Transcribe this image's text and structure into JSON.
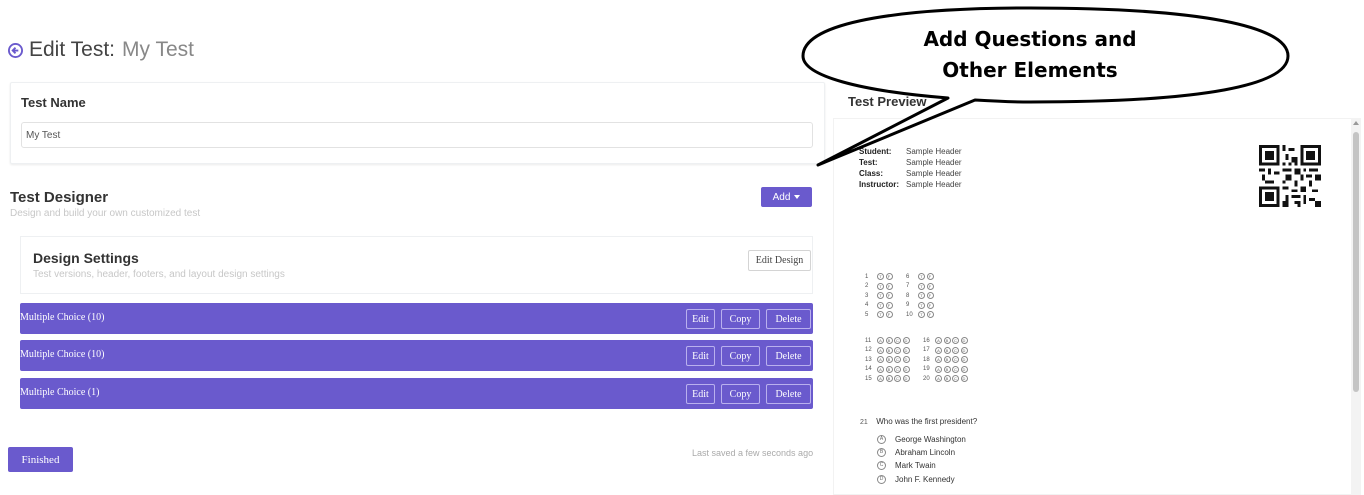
{
  "header": {
    "title_prefix": "Edit Test:",
    "title_name": "My Test"
  },
  "test_name": {
    "label": "Test Name",
    "value": "My Test"
  },
  "designer": {
    "title": "Test Designer",
    "subtitle": "Design and build your own customized test",
    "add_label": "Add"
  },
  "design_settings": {
    "title": "Design Settings",
    "subtitle": "Test versions, header, footers, and layout design settings",
    "edit_label": "Edit Design"
  },
  "sections": [
    {
      "label": "Multiple Choice (10)",
      "edit": "Edit",
      "copy": "Copy",
      "delete": "Delete"
    },
    {
      "label": "Multiple Choice (10)",
      "edit": "Edit",
      "copy": "Copy",
      "delete": "Delete"
    },
    {
      "label": "Multiple Choice (1)",
      "edit": "Edit",
      "copy": "Copy",
      "delete": "Delete"
    }
  ],
  "footer": {
    "finished_label": "Finished",
    "last_saved": "Last saved a few seconds ago"
  },
  "preview": {
    "title": "Test Preview",
    "header_rows": [
      {
        "key": "Student:",
        "value": "Sample Header"
      },
      {
        "key": "Test:",
        "value": "Sample Header"
      },
      {
        "key": "Class:",
        "value": "Sample Header"
      },
      {
        "key": "Instructor:",
        "value": "Sample Header"
      }
    ],
    "block_one": {
      "left_numbers": [
        "1",
        "2",
        "3",
        "4",
        "5"
      ],
      "right_numbers": [
        "6",
        "7",
        "8",
        "9",
        "10"
      ],
      "bubbles": [
        "T",
        "F"
      ]
    },
    "block_two": {
      "left_numbers": [
        "11",
        "12",
        "13",
        "14",
        "15"
      ],
      "right_numbers": [
        "16",
        "17",
        "18",
        "19",
        "20"
      ],
      "bubbles": [
        "A",
        "B",
        "C",
        "D"
      ]
    },
    "question": {
      "number": "21",
      "text": "Who was the first president?",
      "choices": [
        {
          "letter": "A",
          "text": "George Washington"
        },
        {
          "letter": "B",
          "text": "Abraham Lincoln"
        },
        {
          "letter": "C",
          "text": "Mark Twain"
        },
        {
          "letter": "D",
          "text": "John F. Kennedy"
        }
      ]
    }
  },
  "callout": {
    "line1": "Add Questions and",
    "line2": "Other Elements"
  },
  "colors": {
    "accent": "#6a5acd",
    "muted_text": "#c7c7c7"
  }
}
